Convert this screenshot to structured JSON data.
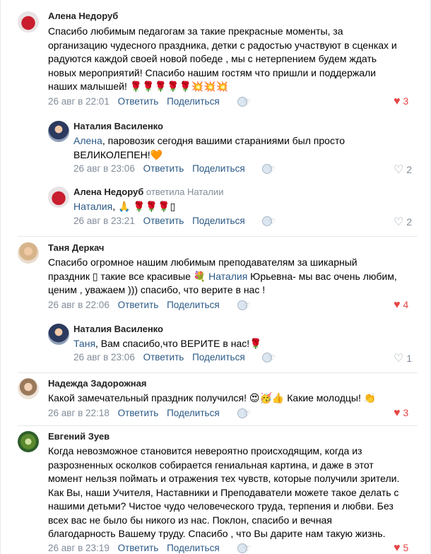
{
  "c1": {
    "name": "Алена Недоруб",
    "lines": [
      "Спасибо любимым педагогам за такие прекрасные моменты, за",
      "организацию чудесного праздника, детки с радостью участвуют в сценках и",
      "радуются каждой своей новой победе , мы с нетерпением будем ждать",
      "новых мероприятий! Спасибо нашим гостям что пришли и поддержали",
      "наших малышей! 🌹🌹🌹🌹🌹💥💥💥"
    ],
    "date": "26 авг в 22:01",
    "reply": "Ответить",
    "share": "Поделиться",
    "likes": "3"
  },
  "r1": {
    "name": "Наталия Василенко",
    "mention": "Алена",
    "line1_rest": ", паровозик сегодня вашими стараниями был просто",
    "line2": "ВЕЛИКОЛЕПЕН!🧡",
    "date": "26 авг в 23:06",
    "reply": "Ответить",
    "share": "Поделиться",
    "likes": "2"
  },
  "r2": {
    "name": "Алена Недоруб",
    "replied_to": "ответила Наталии",
    "mention": "Наталия",
    "rest": ", 🙏 🌹🌹🌹▯",
    "date": "26 авг в 23:21",
    "reply": "Ответить",
    "share": "Поделиться",
    "likes": "2"
  },
  "c2": {
    "name": "Таня Деркач",
    "line1": "Спасибо огромное нашим любимым преподавателям за шикарный",
    "line2_a": "праздник ▯ такие все красивые 💐 ",
    "line2_mention": "Наталия",
    "line2_b": " Юрьевна- мы вас очень любим,",
    "line3": "ценим , уважаем ))) спасибо, что верите в нас !",
    "date": "26 авг в 22:06",
    "reply": "Ответить",
    "share": "Поделиться",
    "likes": "4"
  },
  "r3": {
    "name": "Наталия Василенко",
    "mention": "Таня",
    "rest": ", Вам спасибо,что ВЕРИТЕ в нас!🌹",
    "date": "26 авг в 23:06",
    "reply": "Ответить",
    "share": "Поделиться",
    "likes": "1"
  },
  "c3": {
    "name": "Надежда Задорожная",
    "text": "Какой замечательный праздник получился! 😍🥳👍 Какие молодцы! 👏",
    "date": "26 авг в 22:18",
    "reply": "Ответить",
    "share": "Поделиться",
    "likes": "3"
  },
  "c4": {
    "name": "Евгений Зуев",
    "lines": [
      "Когда невозможное становится невероятно происходящим, когда из",
      "разрозненных осколков собирается гениальная картина, и даже в этот",
      "момент нельзя поймать и отражения тех чувств, которые получили зрители.",
      "Как Вы, наши Учителя, Наставники и Преподаватели можете такое делать с",
      "нашими детьми? Чистое чудо человеческого труда, терпения и любви. Без",
      "всех вас не было бы никого из нас. Поклон, спасибо и вечная",
      "благодарность Вашему труду. Спасибо , что Вы дарите нам такую жизнь."
    ],
    "date": "26 авг в 23:19",
    "reply": "Ответить",
    "share": "Поделиться",
    "likes": "5"
  },
  "icons": {
    "heart": "heart-icon",
    "reaction": "reaction-icon"
  },
  "colors": {
    "link": "#2a5885",
    "meta": "#818c99",
    "heart_active": "#e64646"
  }
}
